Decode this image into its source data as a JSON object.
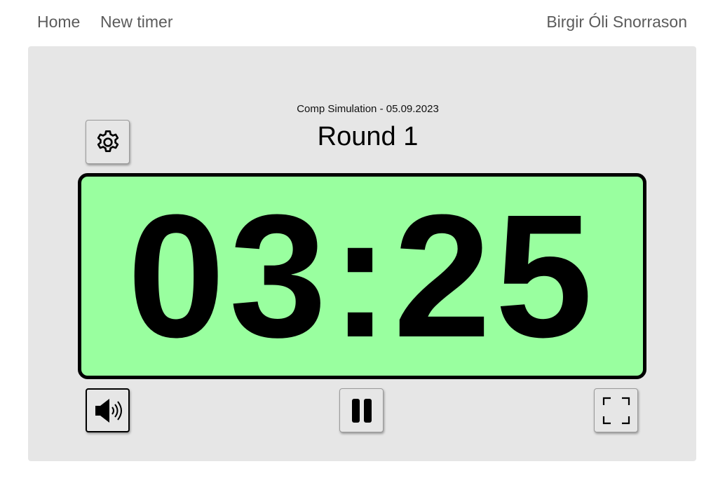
{
  "nav": {
    "home": "Home",
    "new_timer": "New timer",
    "user": "Birgir Óli Snorrason"
  },
  "timer": {
    "subtitle": "Comp Simulation - 05.09.2023",
    "round": "Round 1",
    "display": "03:25",
    "background_color": "#99ff9f"
  },
  "controls": {
    "settings_icon": "gear-icon",
    "sound_icon": "speaker-on-icon",
    "pause_icon": "pause-icon",
    "fullscreen_icon": "fullscreen-icon"
  }
}
